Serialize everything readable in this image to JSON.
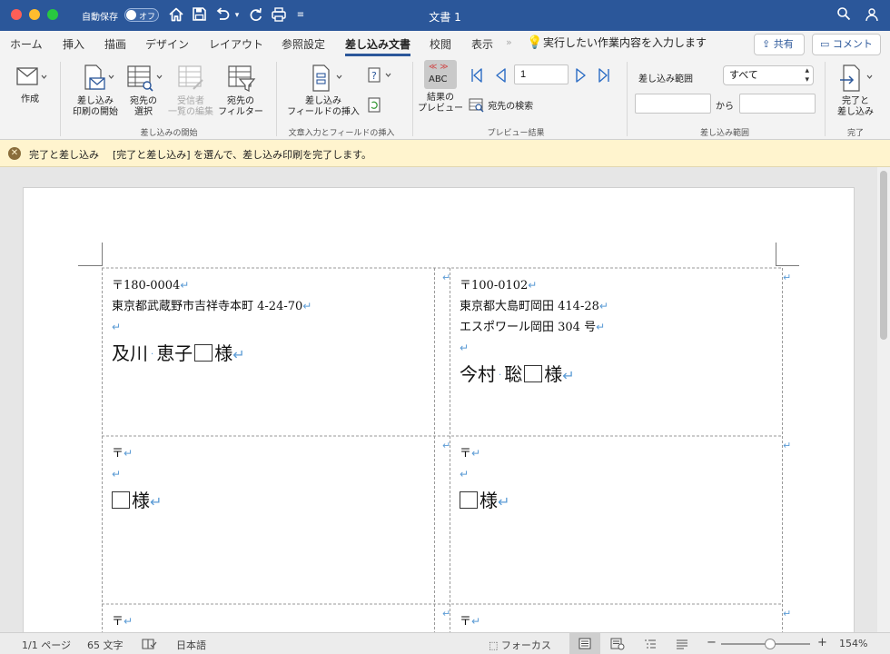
{
  "window": {
    "title": "文書 1",
    "autosave_label": "自動保存",
    "autosave_state": "オフ"
  },
  "tabs": [
    "ホーム",
    "挿入",
    "描画",
    "デザイン",
    "レイアウト",
    "参照設定",
    "差し込み文書",
    "校閲",
    "表示"
  ],
  "active_tab": "差し込み文書",
  "tell_me": "実行したい作業内容を入力します",
  "share_label": "共有",
  "comment_label": "コメント",
  "ribbon": {
    "create": "作成",
    "start_mail_merge": [
      "差し込み",
      "印刷の開始"
    ],
    "select_recipients": [
      "宛先の",
      "選択"
    ],
    "edit_recipient_list": [
      "受信者",
      "一覧の編集"
    ],
    "recipient_filter": [
      "宛先の",
      "フィルター"
    ],
    "group_start": "差し込みの開始",
    "insert_merge_field": [
      "差し込み",
      "フィールドの挿入"
    ],
    "group_insert": "文章入力とフィールドの挿入",
    "preview_results": [
      "結果の",
      "プレビュー"
    ],
    "preview_abc": "ABC",
    "record_number": "1",
    "find_recipient": "宛先の検索",
    "group_preview": "プレビュー結果",
    "merge_range_label": "差し込み範囲",
    "merge_range_value": "すべて",
    "from_label": "から",
    "group_range": "差し込み範囲",
    "finish_merge": [
      "完了と",
      "差し込み"
    ],
    "group_finish": "完了"
  },
  "message_bar": {
    "title": "完了と差し込み",
    "text": "[完了と差し込み] を選んで、差し込み印刷を完了します。"
  },
  "labels": [
    {
      "postal": "〒180-0004",
      "address": [
        "東京都武蔵野市吉祥寺本町 4-24-70",
        ""
      ],
      "last_name": "及川",
      "first_name": "恵子",
      "honorific": "様"
    },
    {
      "postal": "〒100-0102",
      "address": [
        "東京都大島町岡田 414-28",
        "エスポワール岡田 304 号",
        ""
      ],
      "last_name": "今村",
      "first_name": "聡",
      "honorific": "様"
    },
    {
      "postal": "〒",
      "address": [
        ""
      ],
      "last_name": "",
      "first_name": "",
      "honorific": "様"
    },
    {
      "postal": "〒",
      "address": [
        ""
      ],
      "last_name": "",
      "first_name": "",
      "honorific": "様"
    },
    {
      "postal": "〒",
      "address": [],
      "last_name": "",
      "first_name": "",
      "honorific": ""
    },
    {
      "postal": "〒",
      "address": [],
      "last_name": "",
      "first_name": "",
      "honorific": ""
    }
  ],
  "status": {
    "page": "1/1 ページ",
    "word_count": "65 文字",
    "language": "日本語",
    "focus": "フォーカス",
    "zoom": "154%",
    "zoom_level": 0.55
  }
}
